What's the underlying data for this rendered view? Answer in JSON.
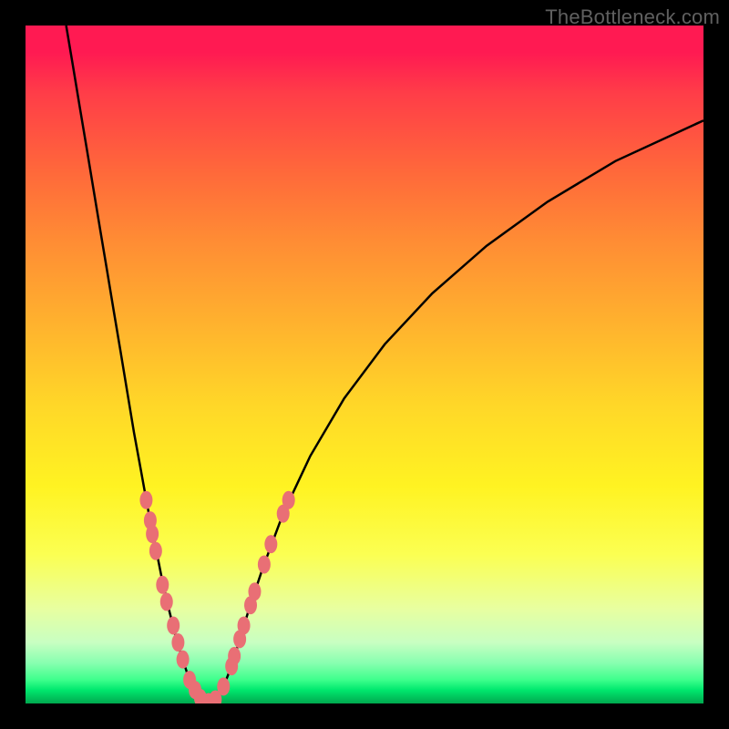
{
  "watermark": "TheBottleneck.com",
  "chart_data": {
    "type": "line",
    "title": "",
    "xlabel": "",
    "ylabel": "",
    "xlim": [
      0,
      100
    ],
    "ylim": [
      0,
      100
    ],
    "annotations": [],
    "background_gradient_stops": [
      {
        "offset": 0,
        "color": "#ff1a52"
      },
      {
        "offset": 4,
        "color": "#ff1a52"
      },
      {
        "offset": 10,
        "color": "#ff3d48"
      },
      {
        "offset": 22,
        "color": "#ff6a3a"
      },
      {
        "offset": 32,
        "color": "#ff8d34"
      },
      {
        "offset": 44,
        "color": "#ffb22e"
      },
      {
        "offset": 56,
        "color": "#ffd728"
      },
      {
        "offset": 68,
        "color": "#fff322"
      },
      {
        "offset": 78,
        "color": "#fbff52"
      },
      {
        "offset": 86,
        "color": "#e8ffa0"
      },
      {
        "offset": 91,
        "color": "#c8ffc2"
      },
      {
        "offset": 94,
        "color": "#88ffb0"
      },
      {
        "offset": 96.5,
        "color": "#3eff8c"
      },
      {
        "offset": 98,
        "color": "#00e86e"
      },
      {
        "offset": 99,
        "color": "#00c85e"
      },
      {
        "offset": 100,
        "color": "#00a84e"
      }
    ],
    "series": [
      {
        "name": "left-branch",
        "stroke": "#000000",
        "points": [
          {
            "x": 6.0,
            "y": 100.0
          },
          {
            "x": 7.0,
            "y": 94.0
          },
          {
            "x": 8.0,
            "y": 88.0
          },
          {
            "x": 9.0,
            "y": 82.0
          },
          {
            "x": 10.0,
            "y": 76.0
          },
          {
            "x": 11.0,
            "y": 70.0
          },
          {
            "x": 12.0,
            "y": 64.0
          },
          {
            "x": 13.0,
            "y": 58.0
          },
          {
            "x": 14.0,
            "y": 52.0
          },
          {
            "x": 15.0,
            "y": 46.0
          },
          {
            "x": 16.0,
            "y": 40.0
          },
          {
            "x": 17.0,
            "y": 34.5
          },
          {
            "x": 18.0,
            "y": 29.0
          },
          {
            "x": 19.0,
            "y": 24.0
          },
          {
            "x": 20.0,
            "y": 19.0
          },
          {
            "x": 21.0,
            "y": 14.5
          },
          {
            "x": 22.0,
            "y": 10.5
          },
          {
            "x": 23.0,
            "y": 7.0
          },
          {
            "x": 24.0,
            "y": 4.0
          },
          {
            "x": 25.0,
            "y": 2.0
          },
          {
            "x": 26.0,
            "y": 0.5
          },
          {
            "x": 27.0,
            "y": 0.0
          }
        ]
      },
      {
        "name": "right-branch",
        "stroke": "#000000",
        "points": [
          {
            "x": 27.0,
            "y": 0.0
          },
          {
            "x": 28.0,
            "y": 0.5
          },
          {
            "x": 29.0,
            "y": 2.0
          },
          {
            "x": 30.0,
            "y": 4.5
          },
          {
            "x": 31.0,
            "y": 7.5
          },
          {
            "x": 33.0,
            "y": 14.0
          },
          {
            "x": 35.0,
            "y": 20.0
          },
          {
            "x": 38.0,
            "y": 28.0
          },
          {
            "x": 42.0,
            "y": 36.5
          },
          {
            "x": 47.0,
            "y": 45.0
          },
          {
            "x": 53.0,
            "y": 53.0
          },
          {
            "x": 60.0,
            "y": 60.5
          },
          {
            "x": 68.0,
            "y": 67.5
          },
          {
            "x": 77.0,
            "y": 74.0
          },
          {
            "x": 87.0,
            "y": 80.0
          },
          {
            "x": 100.0,
            "y": 86.0
          }
        ]
      },
      {
        "name": "highlight-dots",
        "stroke": "#e96f75",
        "kind": "scatter",
        "points": [
          {
            "x": 17.8,
            "y": 30.0
          },
          {
            "x": 18.4,
            "y": 27.0
          },
          {
            "x": 18.7,
            "y": 25.0
          },
          {
            "x": 19.2,
            "y": 22.5
          },
          {
            "x": 20.2,
            "y": 17.5
          },
          {
            "x": 20.8,
            "y": 15.0
          },
          {
            "x": 21.8,
            "y": 11.5
          },
          {
            "x": 22.5,
            "y": 9.0
          },
          {
            "x": 23.2,
            "y": 6.5
          },
          {
            "x": 24.2,
            "y": 3.5
          },
          {
            "x": 25.0,
            "y": 2.0
          },
          {
            "x": 25.8,
            "y": 0.8
          },
          {
            "x": 27.0,
            "y": 0.2
          },
          {
            "x": 28.0,
            "y": 0.6
          },
          {
            "x": 29.2,
            "y": 2.5
          },
          {
            "x": 30.4,
            "y": 5.5
          },
          {
            "x": 30.8,
            "y": 7.0
          },
          {
            "x": 31.6,
            "y": 9.5
          },
          {
            "x": 32.2,
            "y": 11.5
          },
          {
            "x": 33.2,
            "y": 14.5
          },
          {
            "x": 33.8,
            "y": 16.5
          },
          {
            "x": 35.2,
            "y": 20.5
          },
          {
            "x": 36.2,
            "y": 23.5
          },
          {
            "x": 38.0,
            "y": 28.0
          },
          {
            "x": 38.8,
            "y": 30.0
          }
        ]
      }
    ]
  }
}
